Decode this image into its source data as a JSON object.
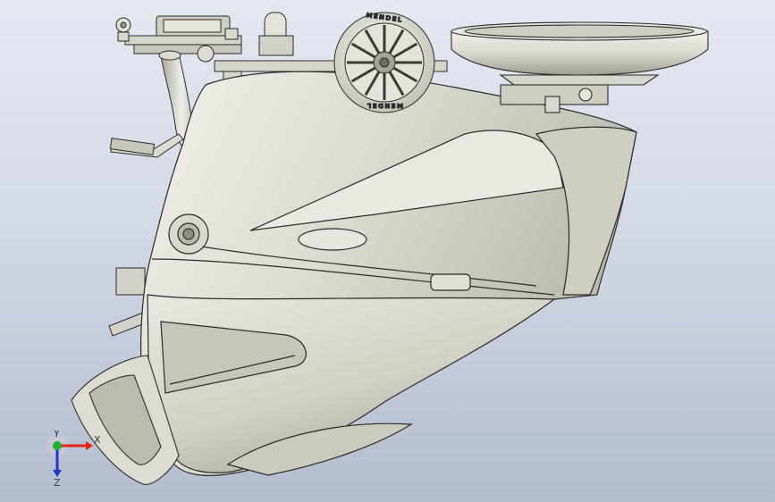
{
  "viewport": {
    "background_top": "#e4e8f1",
    "background_bottom": "#b3bccd",
    "model_fill": "#e3e2d9",
    "model_edge": "#2b2b28"
  },
  "model": {
    "fan_wheel_text_top": "MENDEL",
    "fan_wheel_text_bottom": "MENDEL"
  },
  "triad": {
    "x_label": "X",
    "y_label": "Y",
    "z_label": "Z",
    "x_color": "#e0241b",
    "y_color": "#1fae2e",
    "z_color": "#2336c9"
  }
}
